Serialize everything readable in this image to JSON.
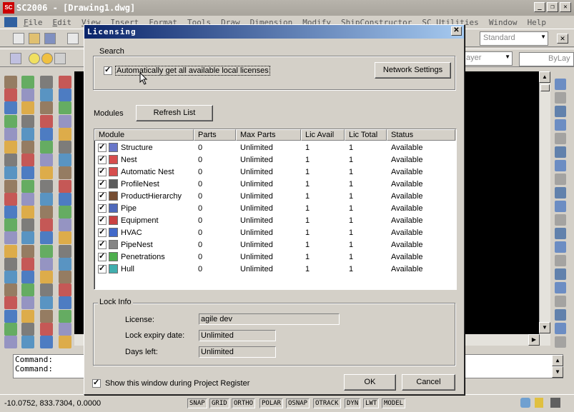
{
  "app": {
    "title": "SC2006 - [Drawing1.dwg]",
    "logo": "SC",
    "menu": [
      {
        "key": "F",
        "rest": "ile"
      },
      {
        "key": "E",
        "rest": "dit"
      },
      {
        "key": "V",
        "rest": "iew"
      },
      {
        "key": "I",
        "rest": "nsert"
      },
      {
        "key": "",
        "rest": "Format"
      },
      {
        "key": "",
        "rest": "Tools"
      },
      {
        "key": "",
        "rest": "Draw"
      },
      {
        "key": "",
        "rest": "Dimension"
      },
      {
        "key": "",
        "rest": "Modify"
      },
      {
        "key": "",
        "rest": "ShipConstructor"
      },
      {
        "key": "",
        "rest": "SC Utilities"
      },
      {
        "key": "",
        "rest": "Window"
      },
      {
        "key": "",
        "rest": "Help"
      }
    ],
    "style_box": "Standard",
    "layer_box": "ayer",
    "linetype_box": "ByLay",
    "command_lines": [
      "Command:",
      "Command:"
    ],
    "coordinates": "-10.0752, 833.7304, 0.0000",
    "status_buttons": [
      "SNAP",
      "GRID",
      "ORTHO",
      "POLAR",
      "OSNAP",
      "OTRACK",
      "DYN",
      "LWT",
      "MODEL"
    ]
  },
  "dialog": {
    "title": "Licensing",
    "close_glyph": "✕",
    "search": {
      "label": "Search",
      "auto_license_label": "Automatically get all available local licenses",
      "auto_license_checked": true,
      "network_settings_label": "Network Settings"
    },
    "modules": {
      "label": "Modules",
      "refresh_label": "Refresh List",
      "columns": [
        "Module",
        "Parts",
        "Max Parts",
        "Lic Avail",
        "Lic Total",
        "Status"
      ],
      "rows": [
        {
          "name": "Structure",
          "icon": "structure-icon",
          "color": "#5060c0",
          "parts": "0",
          "max_parts": "Unlimited",
          "lic_avail": "1",
          "lic_total": "1",
          "status": "Available",
          "checked": true
        },
        {
          "name": "Nest",
          "icon": "nest-icon",
          "color": "#d03030",
          "parts": "0",
          "max_parts": "Unlimited",
          "lic_avail": "1",
          "lic_total": "1",
          "status": "Available",
          "checked": true
        },
        {
          "name": "Automatic Nest",
          "icon": "automatic-nest-icon",
          "color": "#d03030",
          "parts": "0",
          "max_parts": "Unlimited",
          "lic_avail": "1",
          "lic_total": "1",
          "status": "Available",
          "checked": true
        },
        {
          "name": "ProfileNest",
          "icon": "profile-nest-icon",
          "color": "#404040",
          "parts": "0",
          "max_parts": "Unlimited",
          "lic_avail": "1",
          "lic_total": "1",
          "status": "Available",
          "checked": true
        },
        {
          "name": "ProductHierarchy",
          "icon": "product-hierarchy-icon",
          "color": "#603010",
          "parts": "0",
          "max_parts": "Unlimited",
          "lic_avail": "1",
          "lic_total": "1",
          "status": "Available",
          "checked": true
        },
        {
          "name": "Pipe",
          "icon": "pipe-icon",
          "color": "#3050b0",
          "parts": "0",
          "max_parts": "Unlimited",
          "lic_avail": "1",
          "lic_total": "1",
          "status": "Available",
          "checked": true
        },
        {
          "name": "Equipment",
          "icon": "equipment-icon",
          "color": "#c02020",
          "parts": "0",
          "max_parts": "Unlimited",
          "lic_avail": "1",
          "lic_total": "1",
          "status": "Available",
          "checked": true
        },
        {
          "name": "HVAC",
          "icon": "hvac-icon",
          "color": "#2050c0",
          "parts": "0",
          "max_parts": "Unlimited",
          "lic_avail": "1",
          "lic_total": "1",
          "status": "Available",
          "checked": true
        },
        {
          "name": "PipeNest",
          "icon": "pipe-nest-icon",
          "color": "#707070",
          "parts": "0",
          "max_parts": "Unlimited",
          "lic_avail": "1",
          "lic_total": "1",
          "status": "Available",
          "checked": true
        },
        {
          "name": "Penetrations",
          "icon": "penetrations-icon",
          "color": "#30a030",
          "parts": "0",
          "max_parts": "Unlimited",
          "lic_avail": "1",
          "lic_total": "1",
          "status": "Available",
          "checked": true
        },
        {
          "name": "Hull",
          "icon": "hull-icon",
          "color": "#20a0a0",
          "parts": "0",
          "max_parts": "Unlimited",
          "lic_avail": "1",
          "lic_total": "1",
          "status": "Available",
          "checked": true
        }
      ]
    },
    "lock_info": {
      "label": "Lock Info",
      "license_label": "License:",
      "license_value": "agile dev",
      "expiry_label": "Lock expiry date:",
      "expiry_value": "Unlimited",
      "days_label": "Days left:",
      "days_value": "Unlimited"
    },
    "show_on_register_label": "Show this window during Project Register",
    "show_on_register_checked": true,
    "ok_label": "OK",
    "cancel_label": "Cancel"
  }
}
